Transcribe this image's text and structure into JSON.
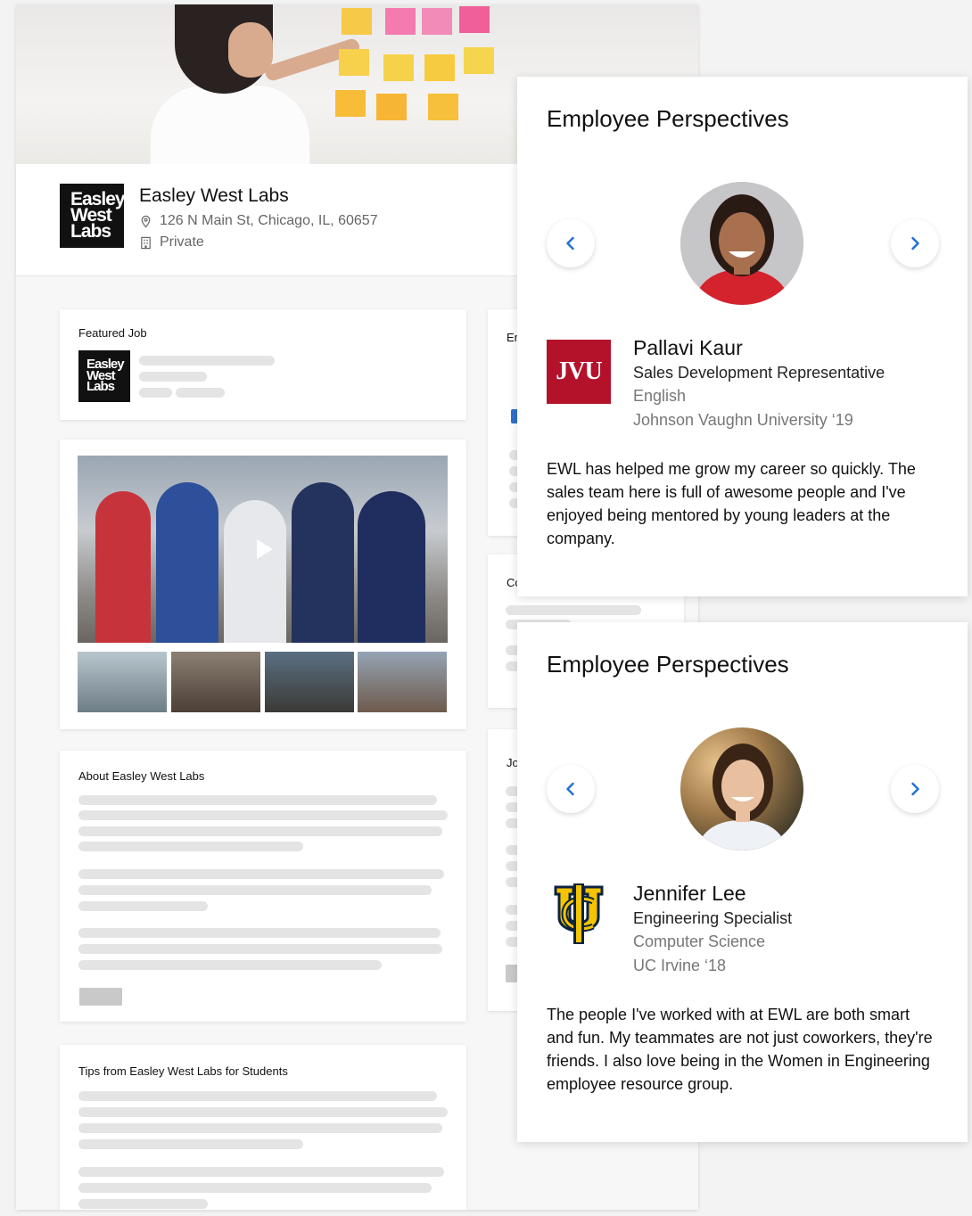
{
  "company": {
    "name": "Easley West Labs",
    "logo_lines": [
      "Easley",
      "West",
      "Labs"
    ],
    "address": "126 N Main St, Chicago, IL, 60657",
    "type": "Private"
  },
  "cards": {
    "featured_job_title": "Featured Job",
    "about_title": "About Easley West Labs",
    "tips_title": "Tips from Easley West Labs for Students",
    "right_col_fragments": [
      "Er",
      "Co",
      "Jo"
    ]
  },
  "perspectives": [
    {
      "title": "Employee Perspectives",
      "name": "Pallavi Kaur",
      "role": "Sales Development Representative",
      "major": "English",
      "school": "Johnson Vaughn University ‘19",
      "school_logo_text": "JVU",
      "quote": "EWL has helped me grow my career so quickly. The sales team here is full of awesome people and I've enjoyed being mentored by young leaders at the company."
    },
    {
      "title": "Employee Perspectives",
      "name": "Jennifer Lee",
      "role": "Engineering Specialist",
      "major": "Computer Science",
      "school": "UC Irvine ‘18",
      "school_logo_text": "UCI",
      "quote": "The people I've worked with at EWL are both smart and fun. My teammates are not just coworkers, they're friends. I also love being in the Women in Engineering employee resource group."
    }
  ],
  "icons": {
    "location": "map-pin-icon",
    "building": "building-icon",
    "prev": "chevron-left-icon",
    "next": "chevron-right-icon",
    "play": "play-icon"
  },
  "colors": {
    "accent_blue": "#1f6fd6",
    "jvu_red": "#b3122a",
    "uci_gold": "#f4c400",
    "uci_navy": "#0c2340"
  }
}
